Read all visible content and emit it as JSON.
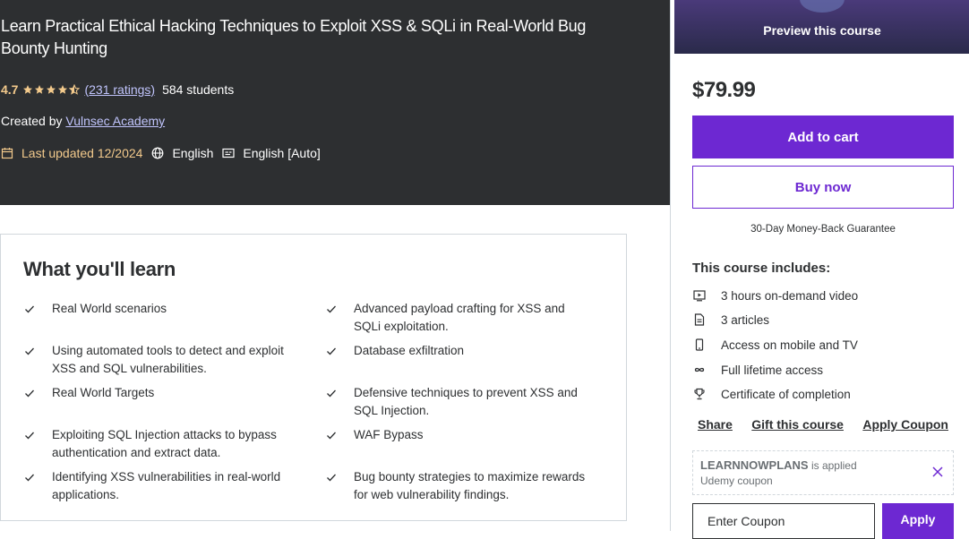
{
  "hero": {
    "title": "Learn Practical Ethical Hacking Techniques to Exploit XSS & SQLi in Real-World Bug Bounty Hunting",
    "rating": "4.7",
    "stars": 4.5,
    "ratings_link": "(231 ratings)",
    "students": "584 students",
    "created_by_label": "Created by",
    "author": "Vulnsec Academy",
    "last_updated": "Last updated 12/2024",
    "language": "English",
    "captions": "English [Auto]"
  },
  "learn": {
    "title": "What you'll learn",
    "items": [
      "Real World scenarios",
      "Advanced payload crafting for XSS and SQLi exploitation.",
      "Using automated tools to detect and exploit XSS and SQL vulnerabilities.",
      "Database exfiltration",
      "Real World Targets",
      "Defensive techniques to prevent XSS and SQL Injection.",
      "Exploiting SQL Injection attacks to bypass authentication and extract data.",
      "WAF Bypass",
      "Identifying XSS vulnerabilities in real-world applications.",
      "Bug bounty strategies to maximize rewards for web vulnerability findings."
    ]
  },
  "sidebar": {
    "preview_label": "Preview this course",
    "price": "$79.99",
    "add_to_cart": "Add to cart",
    "buy_now": "Buy now",
    "guarantee": "30-Day Money-Back Guarantee",
    "includes_title": "This course includes:",
    "includes": [
      {
        "icon": "video-icon",
        "text": "3 hours on-demand video"
      },
      {
        "icon": "article-icon",
        "text": "3 articles"
      },
      {
        "icon": "mobile-icon",
        "text": "Access on mobile and TV"
      },
      {
        "icon": "infinity-icon",
        "text": "Full lifetime access"
      },
      {
        "icon": "trophy-icon",
        "text": "Certificate of completion"
      }
    ],
    "share": "Share",
    "gift": "Gift this course",
    "apply_coupon": "Apply Coupon",
    "coupon_code": "LEARNNOWPLANS",
    "coupon_applied_text": "is applied",
    "coupon_sub": "Udemy coupon",
    "coupon_placeholder": "Enter Coupon",
    "apply_button": "Apply"
  },
  "colors": {
    "accent": "#6d28d2",
    "hero_bg": "#2d2f31",
    "star": "#f3ca8c",
    "link": "#c0c4fc"
  }
}
